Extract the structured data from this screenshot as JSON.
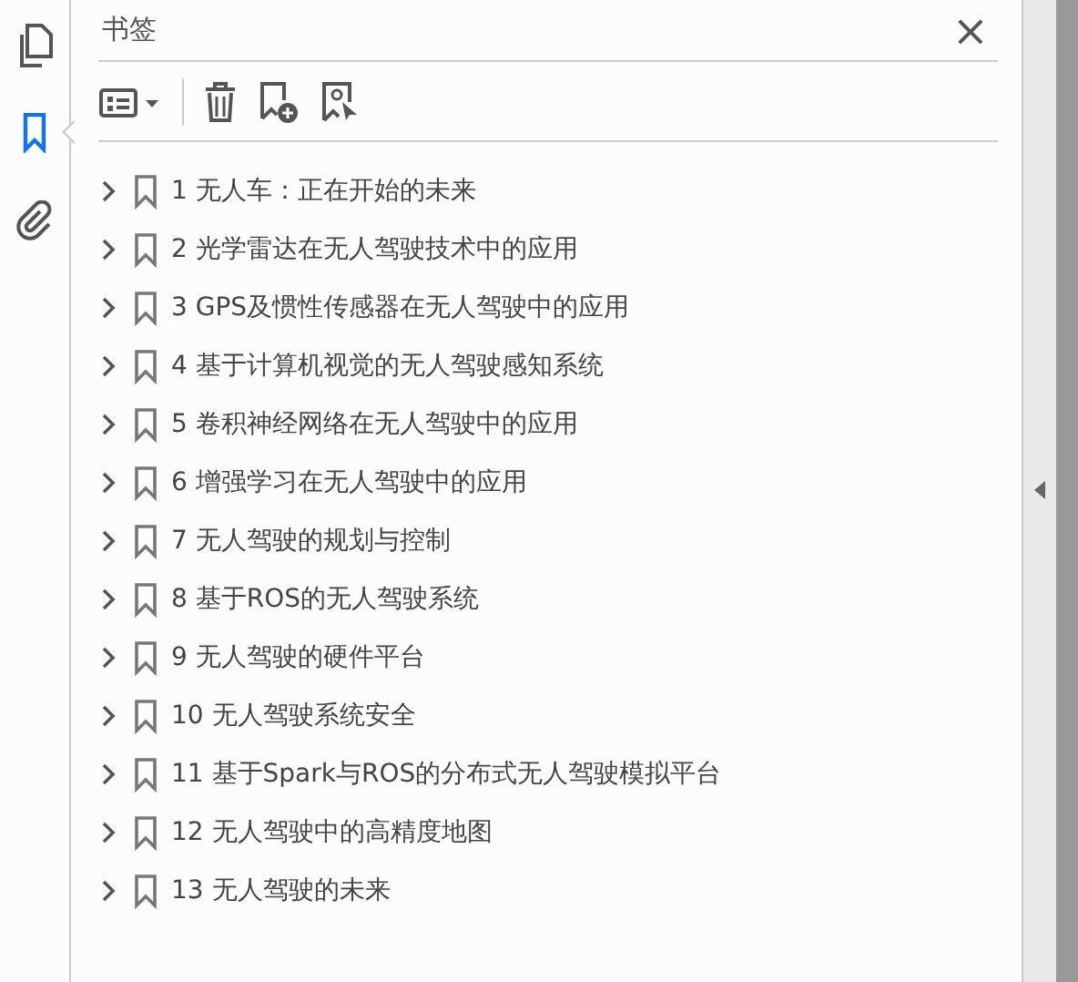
{
  "rail": [
    {
      "kind": "pages",
      "selected": false
    },
    {
      "kind": "bookmarks",
      "selected": true
    },
    {
      "kind": "attachments",
      "selected": false
    }
  ],
  "panel": {
    "title": "书签",
    "close": "×"
  },
  "bookmarks": [
    {
      "label": "1 无人车：正在开始的未来",
      "expanded": false
    },
    {
      "label": "2 光学雷达在无人驾驶技术中的应用",
      "expanded": false
    },
    {
      "label": "3 GPS及惯性传感器在无人驾驶中的应用",
      "expanded": false
    },
    {
      "label": "4 基于计算机视觉的无人驾驶感知系统",
      "expanded": false
    },
    {
      "label": "5 卷积神经网络在无人驾驶中的应用",
      "expanded": false
    },
    {
      "label": "6 增强学习在无人驾驶中的应用",
      "expanded": false
    },
    {
      "label": "7 无人驾驶的规划与控制",
      "expanded": false
    },
    {
      "label": "8 基于ROS的无人驾驶系统",
      "expanded": false
    },
    {
      "label": "9 无人驾驶的硬件平台",
      "expanded": false
    },
    {
      "label": "10 无人驾驶系统安全",
      "expanded": false
    },
    {
      "label": "11 基于Spark与ROS的分布式无人驾驶模拟平台",
      "expanded": false
    },
    {
      "label": "12 无人驾驶中的高精度地图",
      "expanded": false
    },
    {
      "label": "13 无人驾驶的未来",
      "expanded": false
    }
  ]
}
